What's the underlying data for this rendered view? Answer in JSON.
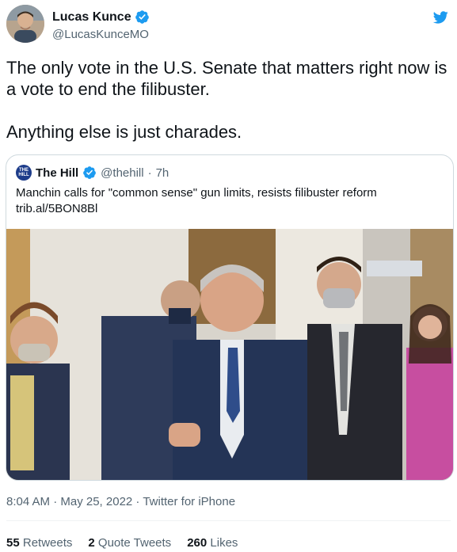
{
  "author": {
    "name": "Lucas Kunce",
    "handle": "@LucasKunceMO",
    "verified": true
  },
  "tweet": {
    "text": "The only vote in the U.S. Senate that matters right now is a vote to end the filibuster.\n\nAnything else is just charades."
  },
  "quoted_tweet": {
    "logo_text": "THE HILL",
    "name": "The Hill",
    "handle": "@thehill",
    "separator": "·",
    "time": "7h",
    "text_line1": "Manchin calls for \"common sense\" gun limits, resists filibuster reform",
    "text_line2": "trib.al/5BON8Bl"
  },
  "meta": {
    "text": "8:04 AM · May 25, 2022 · Twitter for iPhone"
  },
  "stats": [
    {
      "count": "55",
      "label": "Retweets"
    },
    {
      "count": "2",
      "label": "Quote Tweets"
    },
    {
      "count": "260",
      "label": "Likes"
    }
  ],
  "colors": {
    "twitter_blue": "#1d9bf0",
    "secondary_text": "#536471",
    "primary_text": "#0f1419"
  },
  "icons": {
    "verified": "verified-badge-icon",
    "brand": "twitter-bird-icon"
  }
}
